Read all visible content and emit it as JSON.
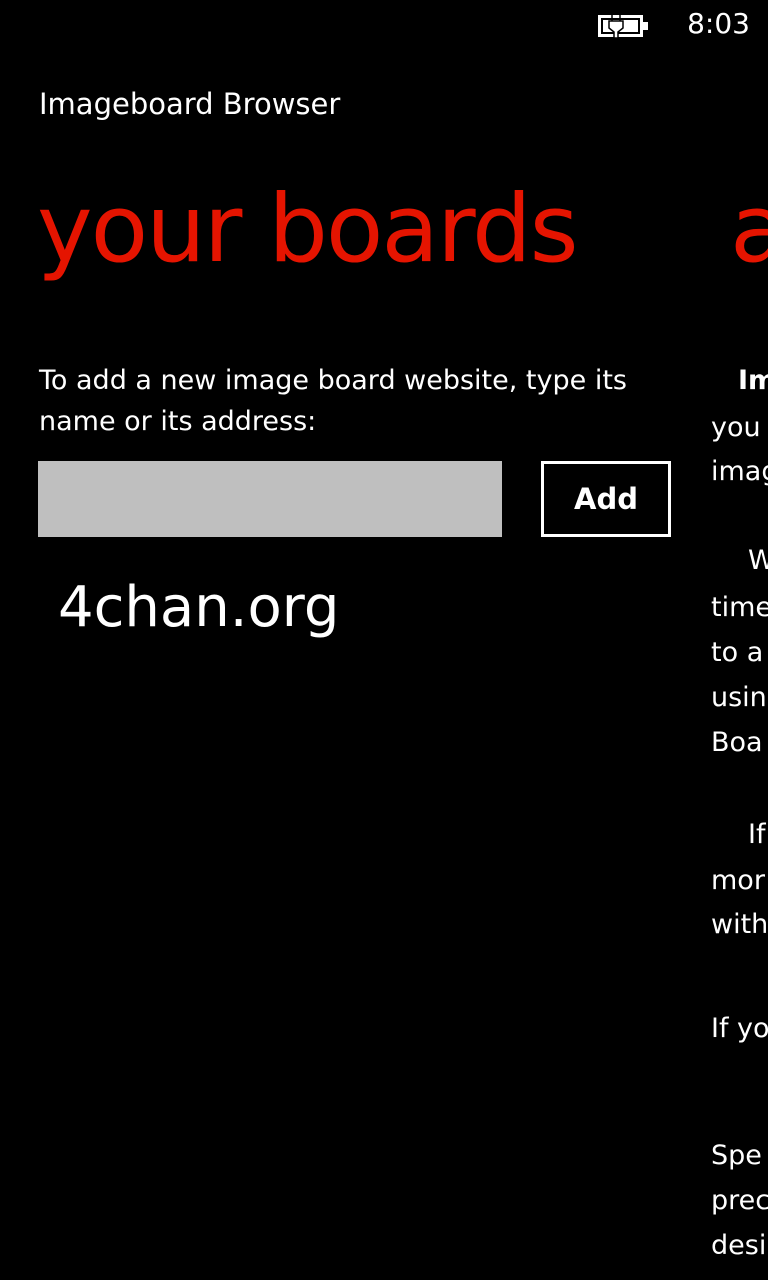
{
  "status_bar": {
    "time": "8:03",
    "battery_icon": "battery-charging-icon"
  },
  "app": {
    "title": "Imageboard Browser"
  },
  "pivot": {
    "current_header": "your boards",
    "next_header_peek": "a"
  },
  "boards_panel": {
    "instruction": "To add a new image board website, type its name or its address:",
    "input_value": "",
    "input_placeholder": "",
    "add_button_label": "Add",
    "boards": [
      {
        "label": "4chan.org"
      }
    ]
  },
  "about_panel_peek": {
    "lines": [
      "Im",
      "you",
      "imag",
      "W",
      "time",
      "to a",
      "usin",
      "Boa",
      "If",
      "mor",
      "with",
      "If yo",
      "Spe",
      "prec",
      "desi"
    ]
  },
  "colors": {
    "accent": "#e51400",
    "background": "#000000",
    "input_background": "#bfbfbf",
    "text": "#ffffff"
  }
}
